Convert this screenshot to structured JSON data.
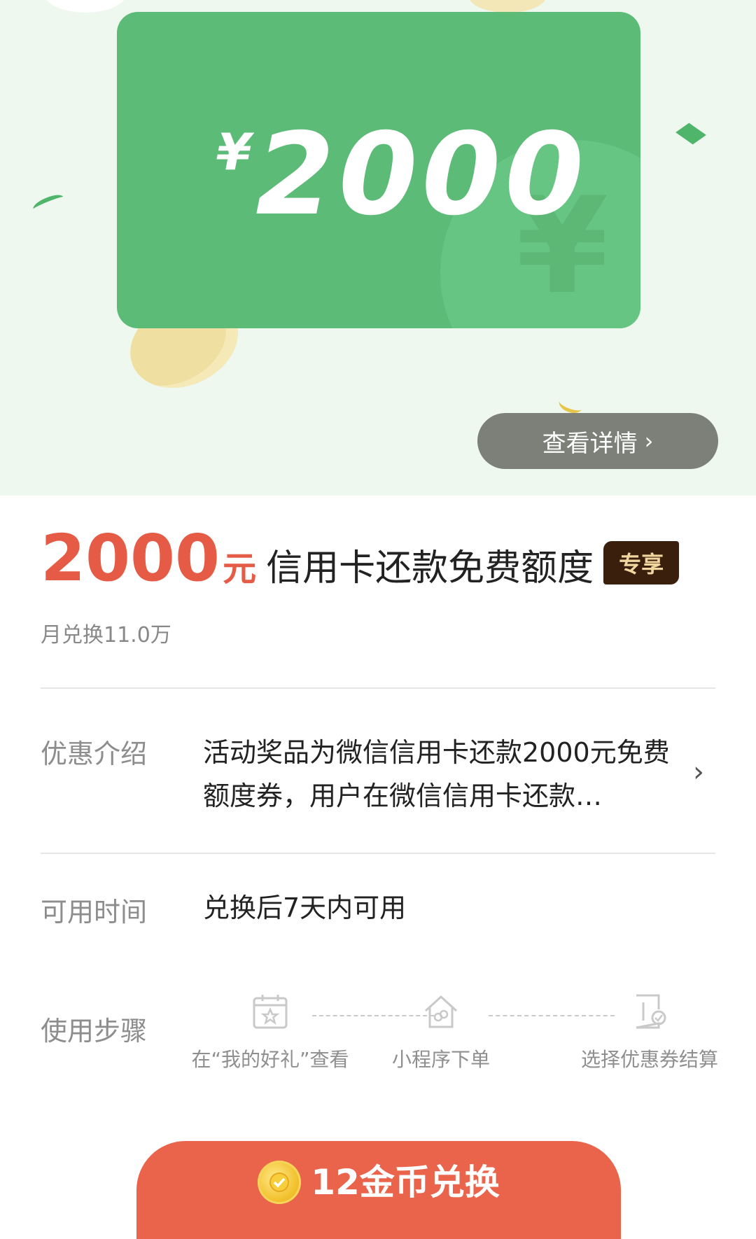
{
  "hero": {
    "card_currency": "¥",
    "card_amount": "2000",
    "card_bg_symbol": "¥",
    "detail_button_label": "查看详情",
    "detail_button_chevron": "›"
  },
  "product": {
    "price": "2000",
    "price_unit": "元",
    "name": "信用卡还款免费额度",
    "badge": "专享",
    "monthly_redeem": "月兑换11.0万"
  },
  "details": {
    "intro_label": "优惠介绍",
    "intro_text": "活动奖品为微信信用卡还款2000元免费额度券，用户在微信信用卡还款…",
    "intro_chevron": "›",
    "time_label": "可用时间",
    "time_value": "兑换后7天内可用",
    "steps_label": "使用步骤",
    "steps": [
      {
        "label": "在“我的好礼”查看",
        "icon": "calendar-star-icon"
      },
      {
        "label": "小程序下单",
        "icon": "home-link-icon"
      },
      {
        "label": "选择优惠券结算",
        "icon": "coupon-check-icon"
      }
    ]
  },
  "cta": {
    "label": "12金币兑换",
    "icon": "gold-coin-icon"
  },
  "colors": {
    "accent_red": "#e65b45",
    "card_green": "#5cbb76",
    "badge_brown": "#3a1f0d",
    "cta_bg": "#e9644a"
  }
}
